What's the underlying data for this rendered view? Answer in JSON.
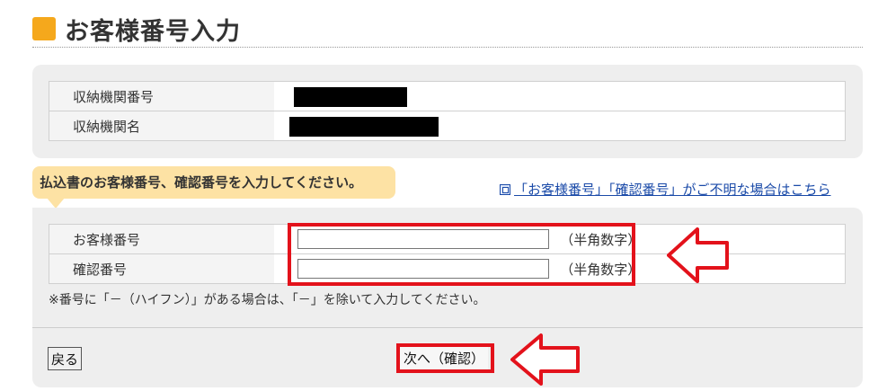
{
  "page": {
    "title": "お客様番号入力"
  },
  "info_table": {
    "rows": [
      {
        "label": "収納機関番号",
        "value": ""
      },
      {
        "label": "収納機関名",
        "value": ""
      }
    ]
  },
  "instruction": {
    "text": "払込書のお客様番号、確認番号を入力してください。"
  },
  "help_link": {
    "text": "「お客様番号」「確認番号」がご不明な場合はこちら"
  },
  "input_table": {
    "rows": [
      {
        "label": "お客様番号",
        "value": "",
        "placeholder": "",
        "hint": "（半角数字）"
      },
      {
        "label": "確認番号",
        "value": "",
        "placeholder": "",
        "hint": "（半角数字）"
      }
    ]
  },
  "note": {
    "text": "※番号に「－（ハイフン）」がある場合は、「－」を除いて入力してください。"
  },
  "buttons": {
    "back_label": "戻る",
    "next_label": "次へ（確認）"
  },
  "colors": {
    "accent": "#f5a81c",
    "highlight": "#e3121b",
    "instruction_bg": "#fde2a4",
    "panel_bg": "#eeeeee",
    "link": "#1a4aa8"
  },
  "icons": {
    "title": "orange-square-icon",
    "link": "window-link-icon",
    "annotation": "left-arrow-icon"
  }
}
